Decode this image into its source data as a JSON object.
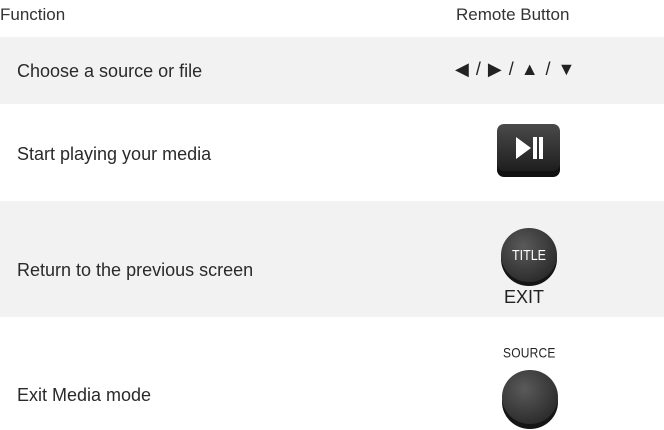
{
  "header": {
    "function_label": "Function",
    "button_label": "Remote Button"
  },
  "rows": [
    {
      "function": "Choose a source or file",
      "button_text": "◀ / ▶ / ▲ / ▼",
      "button_icon": "arrow-keys"
    },
    {
      "function": "Start playing your media",
      "button_icon": "play-pause-icon"
    },
    {
      "function": "Return to the previous screen",
      "button_face_text": "TITLE",
      "button_caption": "EXIT",
      "button_icon": "title-button"
    },
    {
      "function": "Exit Media mode",
      "button_caption": "SOURCE",
      "button_icon": "source-button"
    }
  ],
  "colors": {
    "row_shade": "#f2f2f2",
    "button_dark": "#3a3a3a",
    "text": "#2a2a2a"
  }
}
